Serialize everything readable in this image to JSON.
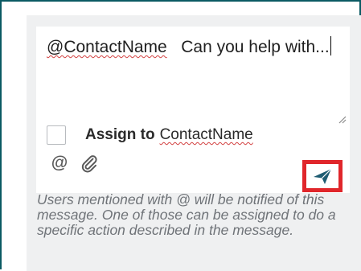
{
  "composer": {
    "mention": "@ContactName",
    "message_text": "Can you help with...",
    "assign_label": "Assign to",
    "assign_name": "ContactName",
    "assign_checked": false
  },
  "toolbar": {
    "mention_symbol": "@",
    "mention_icon": "at-icon",
    "attach_icon": "paperclip-icon",
    "send_icon": "send-icon"
  },
  "help_text": "Users mentioned with @ will be notified of this message. One of those can be assigned to do a specific action described in the message.",
  "colors": {
    "frame_border": "#0b5a63",
    "send_accent": "#1f5d73",
    "highlight": "#e0262b"
  }
}
